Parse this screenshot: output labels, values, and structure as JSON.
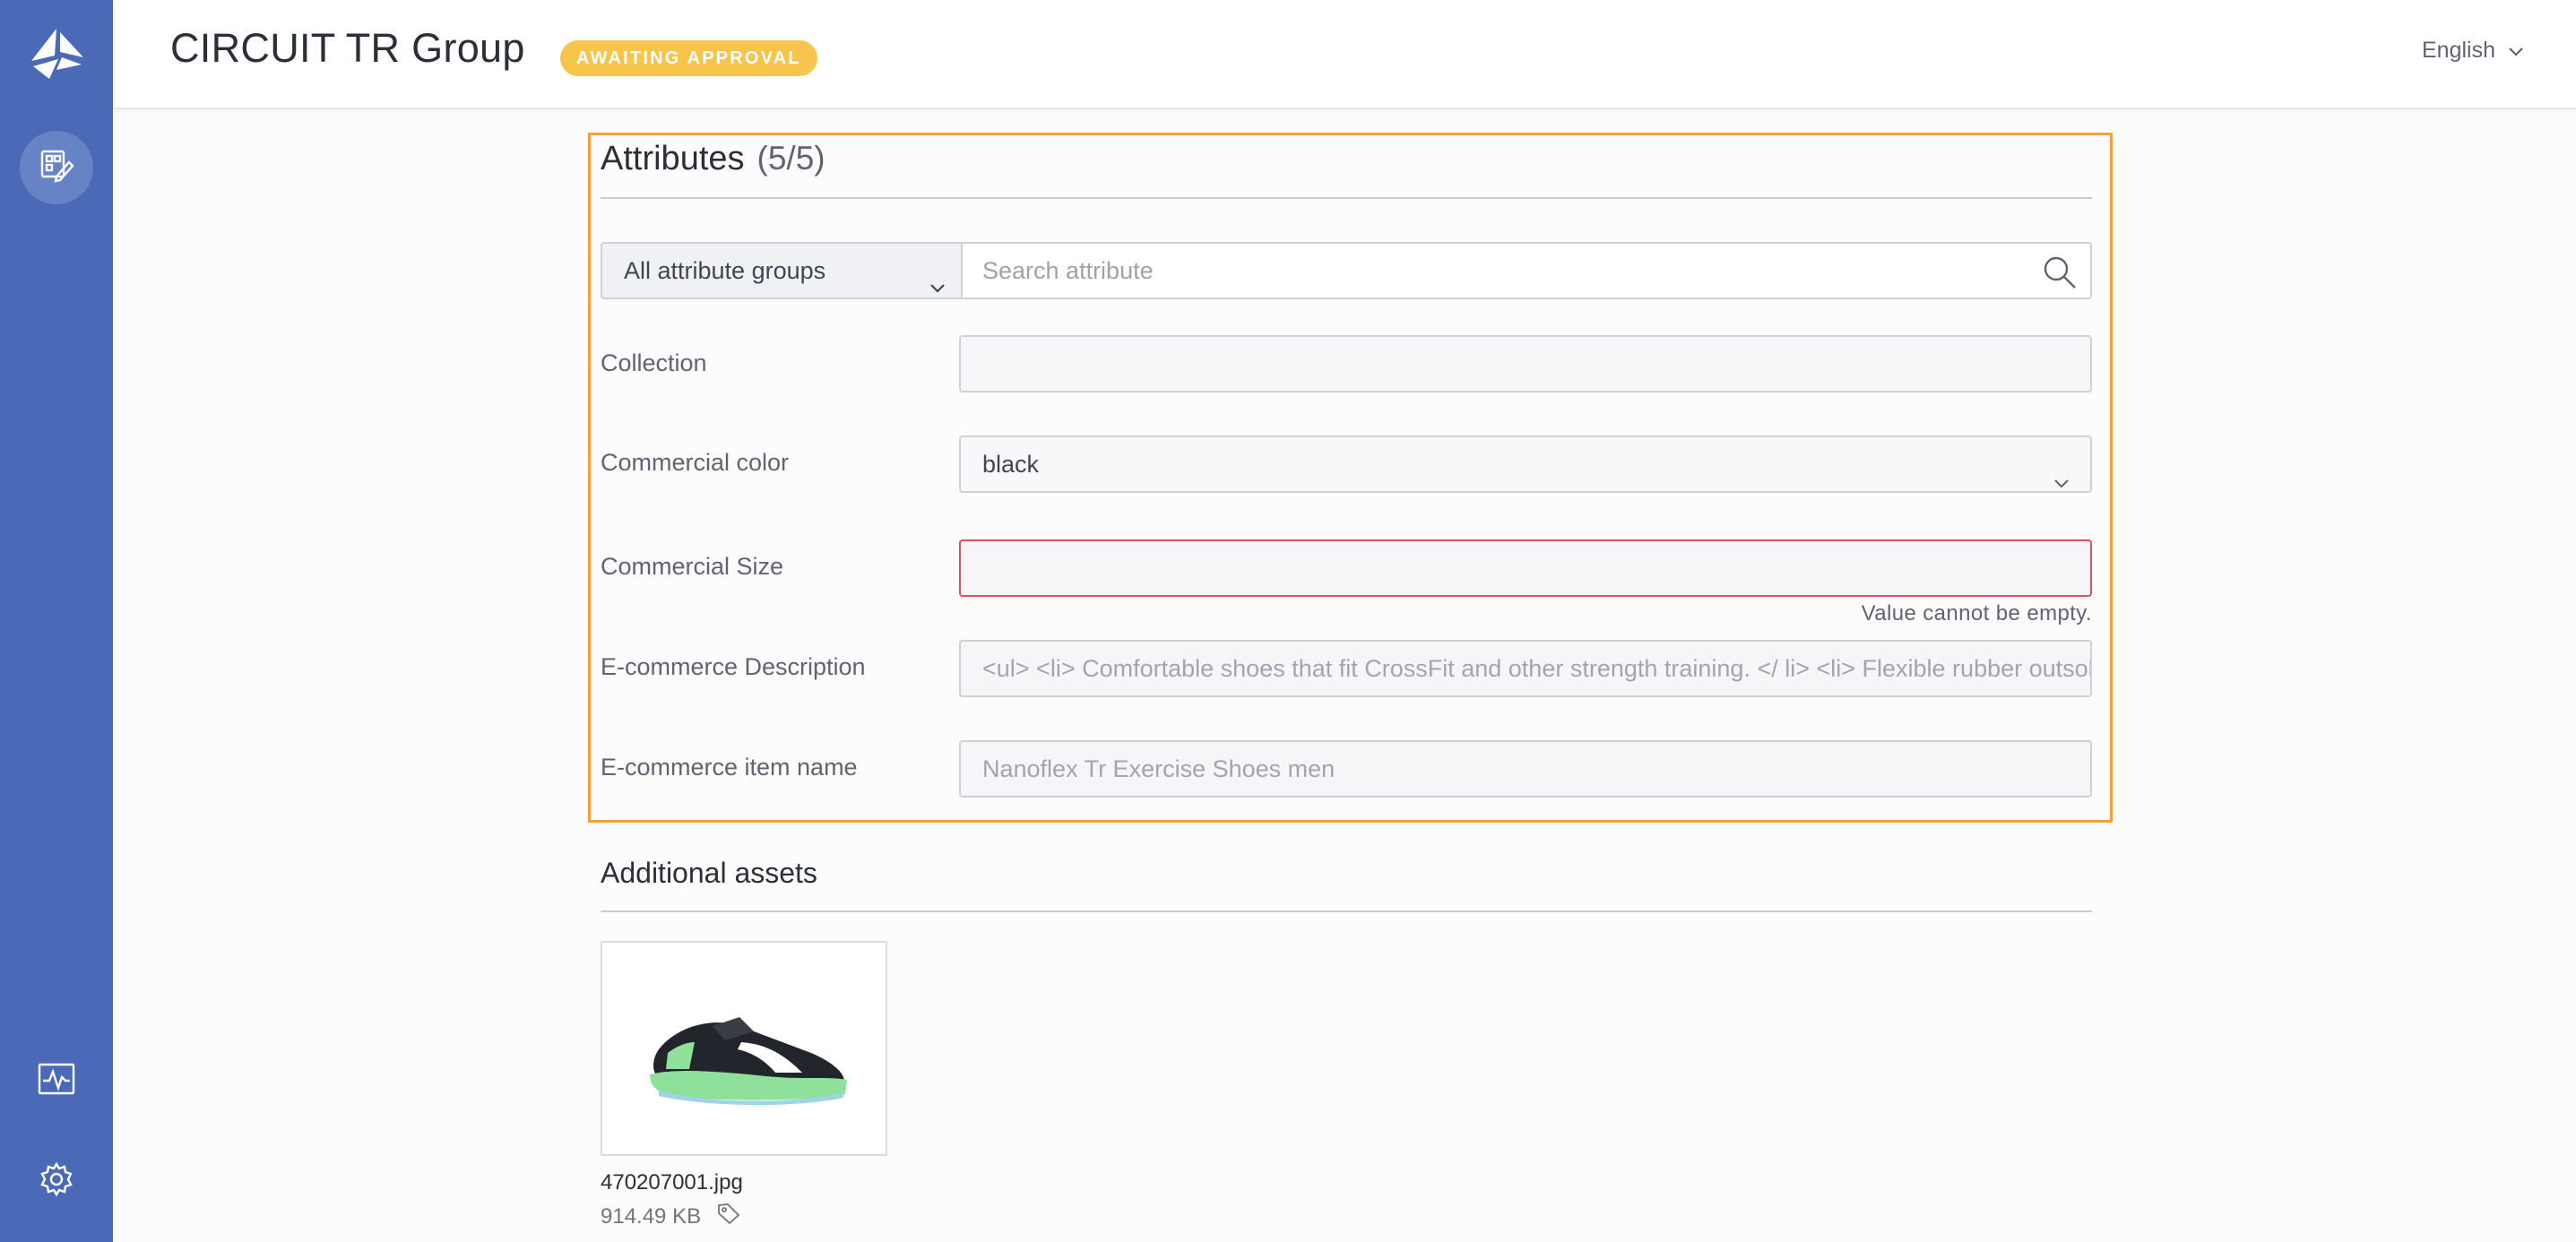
{
  "header": {
    "title": "CIRCUIT TR Group",
    "status": "AWAITING APPROVAL",
    "language": "English"
  },
  "sidebar": {
    "items": [
      {
        "icon": "logo-icon"
      },
      {
        "icon": "product-edit-icon",
        "active": true
      },
      {
        "icon": "activity-icon"
      },
      {
        "icon": "gear-icon"
      }
    ]
  },
  "attributes": {
    "title": "Attributes",
    "count": "(5/5)",
    "group_filter": "All attribute groups",
    "search_placeholder": "Search attribute",
    "fields": [
      {
        "label": "Collection",
        "value": ""
      },
      {
        "label": "Commercial color",
        "value": "black"
      },
      {
        "label": "Commercial Size",
        "value": "",
        "error": "Value cannot be empty."
      },
      {
        "label": "E-commerce Description",
        "value": "<ul> <li> Comfortable shoes that fit CrossFit and other strength training. </ li> <li> Flexible rubber outsole </li>"
      },
      {
        "label": "E-commerce item name",
        "value": "Nanoflex Tr Exercise Shoes men"
      }
    ]
  },
  "assets": {
    "title": "Additional assets",
    "items": [
      {
        "filename": "470207001.jpg",
        "size": "914.49 KB"
      }
    ]
  },
  "colors": {
    "sidebar": "#4a69b6",
    "accent_border": "#f3a13c",
    "badge": "#f7c44c",
    "error": "#d8545a"
  }
}
